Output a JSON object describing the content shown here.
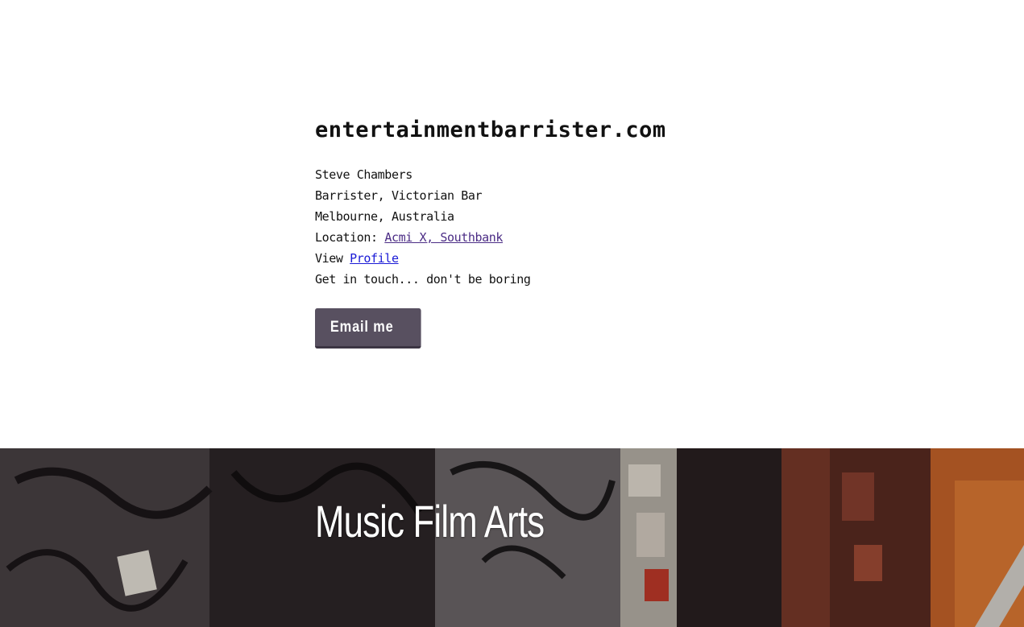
{
  "site": {
    "title": "entertainmentbarrister.com"
  },
  "contact": {
    "name": "Steve Chambers",
    "role": "Barrister, Victorian Bar",
    "city": "Melbourne, Australia",
    "location_prefix": "Location: ",
    "location_link": "Acmi X, Southbank",
    "view_prefix": "View ",
    "profile_link": "Profile",
    "tagline": "Get in touch... don't be boring"
  },
  "cta": {
    "email_label": "Email me"
  },
  "banner": {
    "title": "Music Film Arts"
  },
  "colors": {
    "button_bg": "#585060",
    "visited_link": "#4b2c85",
    "link": "#1a1ad6"
  }
}
